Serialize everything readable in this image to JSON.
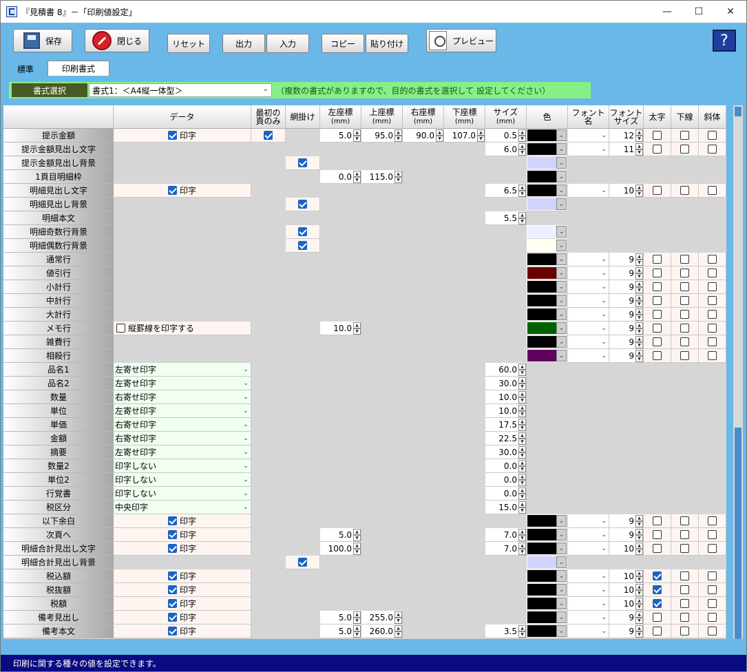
{
  "window": {
    "title": "『見積書 8』－「印刷値設定」"
  },
  "toolbar": {
    "save": "保存",
    "close": "閉じる",
    "reset": "リセット",
    "output": "出力",
    "input": "入力",
    "copy": "コピー",
    "paste": "貼り付け",
    "preview": "プレビュー"
  },
  "tabs": [
    "標準",
    "印刷書式"
  ],
  "format": {
    "label": "書式選択",
    "value": "書式1：＜A4縦一体型＞",
    "note": "（複数の書式がありますので、目的の書式を選択して 設定してください）"
  },
  "headers": {
    "data": "データ",
    "first1": "最初の",
    "first2": "頁のみ",
    "mesh": "網掛け",
    "left": "左座標",
    "top": "上座標",
    "right": "右座標",
    "bottom": "下座標",
    "size": "サイズ",
    "mm": "(mm)",
    "color": "色",
    "font": "フォント名",
    "fsize1": "フォント",
    "fsize2": "サイズ",
    "bold": "太字",
    "under": "下線",
    "italic": "斜体"
  },
  "rows": [
    {
      "label": "提示金額",
      "kind": "print",
      "printText": "印字",
      "first": true,
      "left": "5.0",
      "top": "95.0",
      "right": "90.0",
      "bottom": "107.0",
      "size": "0.5",
      "color": "#000000",
      "font": true,
      "fsize": "12",
      "bold": false,
      "under": false,
      "italic": false
    },
    {
      "label": "提示金額見出し文字",
      "kind": "none",
      "size": "6.0",
      "color": "#000000",
      "font": true,
      "fsize": "11",
      "bold": false,
      "under": false,
      "italic": false
    },
    {
      "label": "提示金額見出し背景",
      "kind": "none",
      "mesh": true,
      "color": "#d2d2ff",
      "bgonly": true
    },
    {
      "label": "1頁目明細枠",
      "kind": "none",
      "left": "0.0",
      "top": "115.0",
      "color": "#000000",
      "bgonly": true
    },
    {
      "label": "明細見出し文字",
      "kind": "print",
      "printText": "印字",
      "size": "6.5",
      "color": "#000000",
      "font": true,
      "fsize": "10",
      "bold": false,
      "under": false,
      "italic": false
    },
    {
      "label": "明細見出し背景",
      "kind": "none",
      "mesh": true,
      "color": "#d2d2ff",
      "bgonly": true
    },
    {
      "label": "明細本文",
      "kind": "none",
      "size": "5.5"
    },
    {
      "label": "明細奇数行背景",
      "kind": "none",
      "mesh": true,
      "color": "#eef0ff",
      "bgonly": true
    },
    {
      "label": "明細偶数行背景",
      "kind": "none",
      "mesh": true,
      "color": "#fffef0",
      "bgonly": true
    },
    {
      "label": "通常行",
      "kind": "none",
      "color": "#000000",
      "font": true,
      "fsize": "9",
      "bold": false,
      "under": false,
      "italic": false
    },
    {
      "label": "値引行",
      "kind": "none",
      "color": "#6b0000",
      "font": true,
      "fsize": "9",
      "bold": false,
      "under": false,
      "italic": false
    },
    {
      "label": "小計行",
      "kind": "none",
      "color": "#000000",
      "font": true,
      "fsize": "9",
      "bold": false,
      "under": false,
      "italic": false
    },
    {
      "label": "中計行",
      "kind": "none",
      "color": "#000000",
      "font": true,
      "fsize": "9",
      "bold": false,
      "under": false,
      "italic": false
    },
    {
      "label": "大計行",
      "kind": "none",
      "color": "#000000",
      "font": true,
      "fsize": "9",
      "bold": false,
      "under": false,
      "italic": false
    },
    {
      "label": "メモ行",
      "kind": "memo",
      "printText": "縦罫線を印字する",
      "left": "10.0",
      "color": "#006000",
      "font": true,
      "fsize": "9",
      "bold": false,
      "under": false,
      "italic": false
    },
    {
      "label": "雑費行",
      "kind": "none",
      "color": "#000000",
      "font": true,
      "fsize": "9",
      "bold": false,
      "under": false,
      "italic": false
    },
    {
      "label": "相殺行",
      "kind": "none",
      "color": "#600060",
      "font": true,
      "fsize": "9",
      "bold": false,
      "under": false,
      "italic": false
    },
    {
      "label": "品名1",
      "kind": "select",
      "sel": "左寄せ印字",
      "size": "60.0"
    },
    {
      "label": "品名2",
      "kind": "select",
      "sel": "左寄せ印字",
      "size": "30.0"
    },
    {
      "label": "数量",
      "kind": "select",
      "sel": "右寄せ印字",
      "size": "10.0"
    },
    {
      "label": "単位",
      "kind": "select",
      "sel": "左寄せ印字",
      "size": "10.0"
    },
    {
      "label": "単価",
      "kind": "select",
      "sel": "右寄せ印字",
      "size": "17.5"
    },
    {
      "label": "金額",
      "kind": "select",
      "sel": "右寄せ印字",
      "size": "22.5"
    },
    {
      "label": "摘要",
      "kind": "select",
      "sel": "左寄せ印字",
      "size": "30.0"
    },
    {
      "label": "数量2",
      "kind": "select",
      "sel": "印字しない",
      "size": "0.0"
    },
    {
      "label": "単位2",
      "kind": "select",
      "sel": "印字しない",
      "size": "0.0"
    },
    {
      "label": "行覚書",
      "kind": "select",
      "sel": "印字しない",
      "size": "0.0"
    },
    {
      "label": "税区分",
      "kind": "select",
      "sel": "中央印字",
      "size": "15.0"
    },
    {
      "label": "以下余白",
      "kind": "print",
      "printText": "印字",
      "color": "#000000",
      "font": true,
      "fsize": "9",
      "bold": false,
      "under": false,
      "italic": false
    },
    {
      "label": "次頁へ",
      "kind": "print",
      "printText": "印字",
      "left": "5.0",
      "size": "7.0",
      "color": "#000000",
      "font": true,
      "fsize": "9",
      "bold": false,
      "under": false,
      "italic": false
    },
    {
      "label": "明細合計見出し文字",
      "kind": "print",
      "printText": "印字",
      "left": "100.0",
      "size": "7.0",
      "color": "#000000",
      "font": true,
      "fsize": "10",
      "bold": false,
      "under": false,
      "italic": false
    },
    {
      "label": "明細合計見出し背景",
      "kind": "none",
      "mesh": true,
      "color": "#d2d2ff",
      "bgonly": true
    },
    {
      "label": "税込額",
      "kind": "print",
      "printText": "印字",
      "color": "#000000",
      "font": true,
      "fsize": "10",
      "bold": true,
      "under": false,
      "italic": false
    },
    {
      "label": "税抜額",
      "kind": "print",
      "printText": "印字",
      "color": "#000000",
      "font": true,
      "fsize": "10",
      "bold": true,
      "under": false,
      "italic": false
    },
    {
      "label": "税額",
      "kind": "print",
      "printText": "印字",
      "color": "#000000",
      "font": true,
      "fsize": "10",
      "bold": true,
      "under": false,
      "italic": false
    },
    {
      "label": "備考見出し",
      "kind": "print",
      "printText": "印字",
      "left": "5.0",
      "top": "255.0",
      "color": "#000000",
      "font": true,
      "fsize": "9",
      "bold": false,
      "under": false,
      "italic": false
    },
    {
      "label": "備考本文",
      "kind": "print",
      "printText": "印字",
      "left": "5.0",
      "top": "260.0",
      "size": "3.5",
      "color": "#000000",
      "font": true,
      "fsize": "9",
      "bold": false,
      "under": false,
      "italic": false
    }
  ],
  "status": "印刷に関する種々の値を設定できます。"
}
